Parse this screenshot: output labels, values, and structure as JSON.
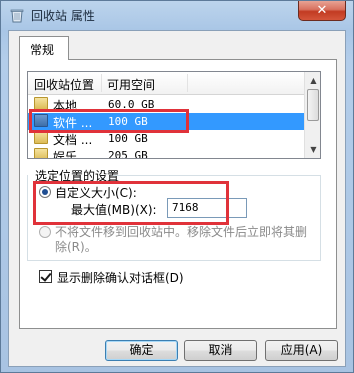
{
  "window": {
    "title": "回收站 属性",
    "close_label": "✕"
  },
  "tabs": [
    {
      "label": "常规"
    }
  ],
  "list": {
    "columns": [
      "回收站位置",
      "可用空间"
    ],
    "rows": [
      {
        "name": "本地",
        "space": "60.0 GB"
      },
      {
        "name": "软件 ...",
        "space": "100 GB",
        "selected": true
      },
      {
        "name": "文档 ...",
        "space": "100 GB"
      },
      {
        "name": "娱乐",
        "space": "205 GB"
      }
    ]
  },
  "settings": {
    "group_label": "选定位置的设置",
    "custom_size_label": "自定义大小(C):",
    "max_label": "最大值(MB)(X):",
    "max_value": "7168",
    "no_move_label_1": "不将文件移到回收站中。移除文件后立即将其删",
    "no_move_label_2": "除(R)。",
    "confirm_label": "显示删除确认对话框(D)"
  },
  "buttons": {
    "ok": "确定",
    "cancel": "取消",
    "apply": "应用(A)"
  },
  "colors": {
    "selection": "#3399ff",
    "highlight_box": "#e0323a"
  }
}
